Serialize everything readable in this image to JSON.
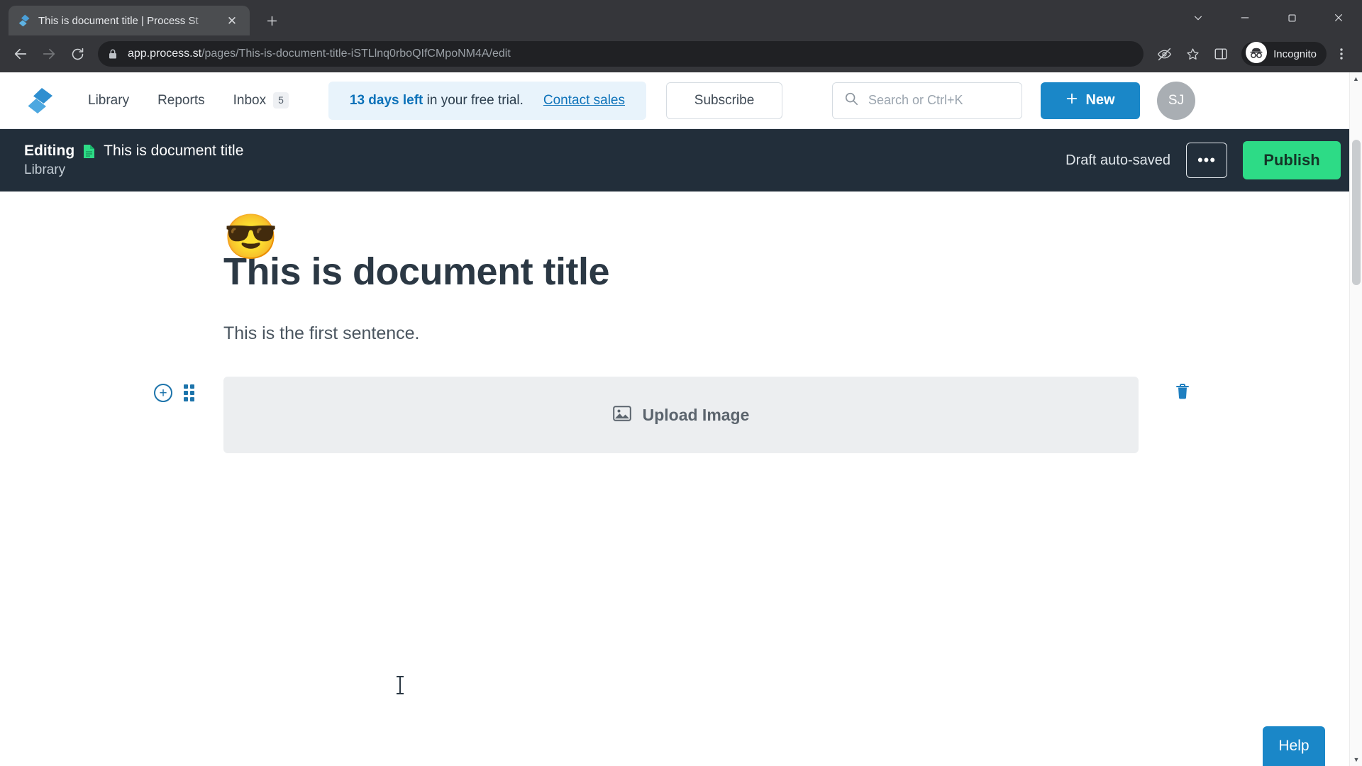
{
  "browser": {
    "tab": {
      "title": "This is document title | Process St",
      "favicon_icon": "process-st-logo-icon",
      "close_icon": "close-icon"
    },
    "new_tab_icon": "plus-icon",
    "window_controls": {
      "minimize_chevron_icon": "chevron-down-icon",
      "minimize_icon": "minimize-icon",
      "maximize_icon": "maximize-icon",
      "close_icon": "window-close-icon"
    },
    "nav": {
      "back_icon": "arrow-back-icon",
      "forward_icon": "arrow-forward-icon",
      "reload_icon": "reload-icon"
    },
    "omnibox": {
      "lock_icon": "lock-icon",
      "url_host": "app.process.st",
      "url_path": "/pages/This-is-document-title-iSTLlnq0rboQIfCMpoNM4A/edit"
    },
    "toolbar_icons": {
      "third_party_cookies_icon": "eye-slash-icon",
      "bookmark_icon": "star-icon",
      "side_panel_icon": "side-panel-icon",
      "menu_icon": "three-dots-vertical-icon"
    },
    "incognito": {
      "icon": "incognito-hat-icon",
      "label": "Incognito"
    }
  },
  "appnav": {
    "logo_icon": "process-st-logo-icon",
    "links": [
      {
        "label": "Library",
        "name": "nav-link-library"
      },
      {
        "label": "Reports",
        "name": "nav-link-reports"
      },
      {
        "label": "Inbox",
        "name": "nav-link-inbox",
        "badge": "5"
      }
    ],
    "trial": {
      "days_left": "13 days left",
      "suffix": " in your free trial.",
      "contact_link": "Contact sales"
    },
    "subscribe_label": "Subscribe",
    "search": {
      "icon": "search-icon",
      "placeholder": "Search or Ctrl+K",
      "value": ""
    },
    "new_button": {
      "plus_icon": "plus-icon",
      "label": "New"
    },
    "avatar_initials": "SJ"
  },
  "editbar": {
    "editing_label": "Editing",
    "doc_icon": "document-icon",
    "doc_name": "This is document title",
    "breadcrumb": "Library",
    "autosave_status": "Draft auto-saved",
    "more_label": "•••",
    "publish_label": "Publish"
  },
  "document": {
    "emoji": "😎",
    "title": "This is document title",
    "paragraph": "This is the first sentence.",
    "block": {
      "add_icon": "plus-circle-icon",
      "drag_icon": "drag-handle-icon",
      "delete_icon": "trash-icon",
      "upload_icon": "image-icon",
      "upload_label": "Upload Image"
    }
  },
  "help": {
    "label": "Help"
  },
  "colors": {
    "brand_blue": "#1a87c8",
    "editbar_dark": "#222e3a",
    "publish_green": "#2ddb86",
    "banner_blue_bg": "#e8f3fb",
    "link_blue": "#0d72b9"
  }
}
